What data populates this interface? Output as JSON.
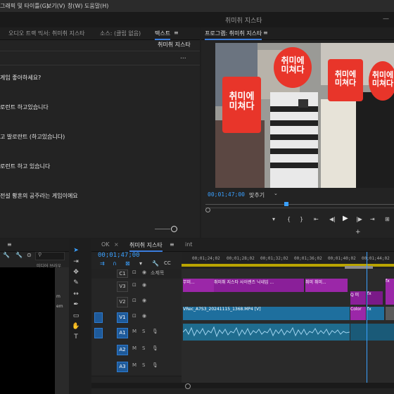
{
  "menu": {
    "items": [
      "그래픽 및 타이틀(G)",
      "보기(V)",
      "창(W)",
      "도움말(H)"
    ]
  },
  "window": {
    "title": "취미취 지스타"
  },
  "left_panel": {
    "tabs": [
      "오디오 트랙 믹서: 취미취 지스타",
      "소스: (클립 없음)",
      "텍스트"
    ],
    "tab_menu_icon": "hamburger-icon",
    "subtitle": "취미취 지스타",
    "more": "...",
    "captions": [
      "게임 좋아하세요?",
      "로런트 하고있습니다",
      "고 발로란트 (하고있습니다)",
      "로런트 하고 있습니다",
      "전설 황혼의 공주라는 게임이에요"
    ]
  },
  "program_monitor": {
    "tab": "프로그램: 취미취 지스타",
    "timecode": "00;01;47;00",
    "fit": "맞추기",
    "sticker_text": [
      "취미에",
      "미쳐다"
    ]
  },
  "project_panel": {
    "text1": "미디어 브라우",
    "text2": "m",
    "text3": "em"
  },
  "timeline": {
    "tabs": [
      "OK",
      "취미취 지스타",
      "int"
    ],
    "timecode": "00;01;47;00",
    "ruler": [
      "00;01;24;02",
      "00;01;28;02",
      "00;01;32;02",
      "00;01;36;02",
      "00;01;40;02",
      "00;01;44;02"
    ],
    "header_label": "소제목",
    "tracks": {
      "video": [
        "V3",
        "V2",
        "V1"
      ],
      "audio": [
        "A1",
        "A2",
        "A3"
      ],
      "c1": "C1"
    },
    "clips": {
      "v3_a": "무미...",
      "v3_b": "취미취 지스타 사이렌즈 닉네임 ...",
      "v3_c": "취미 취미...",
      "v2_a": "Q 미",
      "v1_main": "VRec_A7S3_20241115_1368.MP4 [V]",
      "v1_color": "Color",
      "fx": "fx"
    },
    "ms_labels": [
      "M",
      "S"
    ]
  }
}
